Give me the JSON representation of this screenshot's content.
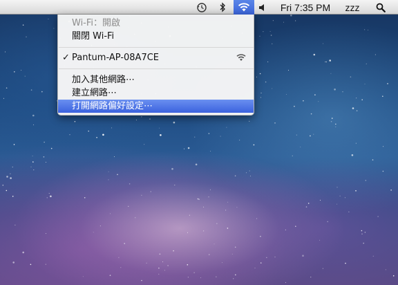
{
  "menubar": {
    "clock": "Fri 7:35 PM",
    "user": "zzz",
    "icons": [
      "time-machine-icon",
      "bluetooth-icon",
      "wifi-icon",
      "volume-icon",
      "spotlight-icon"
    ]
  },
  "wifi_menu": {
    "status": "Wi-Fi：開啟",
    "toggle": "關閉 Wi-Fi",
    "networks": [
      {
        "name": "Pantum-AP-08A7CE",
        "connected": true,
        "check": "✓"
      }
    ],
    "other_network": "加入其他網路⋯",
    "create_network": "建立網路⋯",
    "open_prefs": "打開網路偏好設定⋯"
  },
  "colors": {
    "highlight": "#3b62de",
    "menubar": "#e4e4e4"
  }
}
